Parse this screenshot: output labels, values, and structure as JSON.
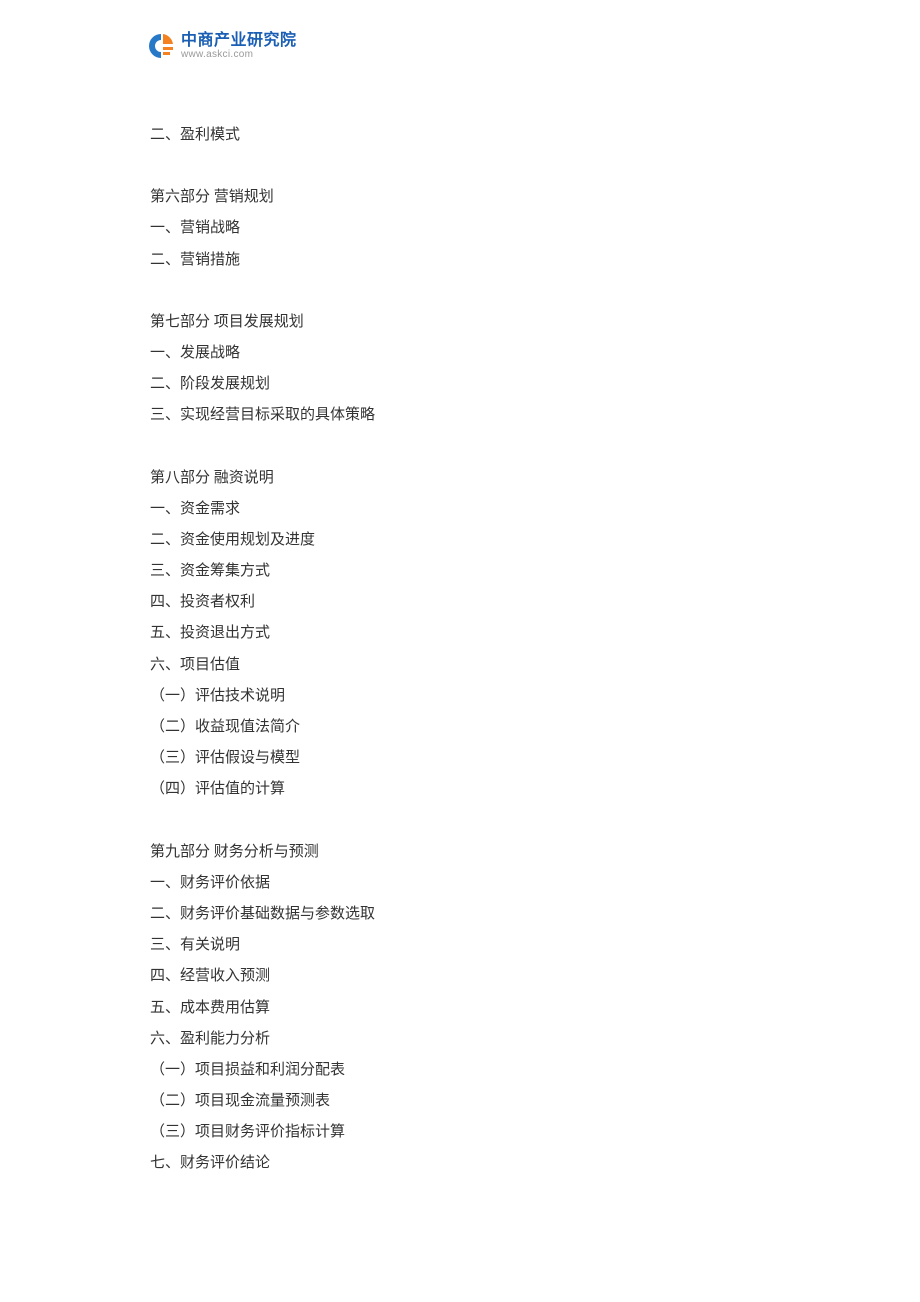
{
  "logo": {
    "title": "中商产业研究院",
    "url": "www.askci.com"
  },
  "toc": {
    "orphan_item": "二、盈利模式",
    "section6": {
      "heading": "第六部分 营销规划",
      "items": [
        "一、营销战略",
        "二、营销措施"
      ]
    },
    "section7": {
      "heading": "第七部分 项目发展规划",
      "items": [
        "一、发展战略",
        "二、阶段发展规划",
        "三、实现经营目标采取的具体策略"
      ]
    },
    "section8": {
      "heading": "第八部分 融资说明",
      "items": [
        "一、资金需求",
        "二、资金使用规划及进度",
        "三、资金筹集方式",
        "四、投资者权利",
        "五、投资退出方式",
        "六、项目估值",
        "（一）评估技术说明",
        "（二）收益现值法简介",
        "（三）评估假设与模型",
        "（四）评估值的计算"
      ]
    },
    "section9": {
      "heading": "第九部分 财务分析与预测",
      "items": [
        "一、财务评价依据",
        "二、财务评价基础数据与参数选取",
        "三、有关说明",
        "四、经营收入预测",
        "五、成本费用估算",
        "六、盈利能力分析",
        "（一）项目损益和利润分配表",
        "（二）项目现金流量预测表",
        "（三）项目财务评价指标计算",
        "七、财务评价结论"
      ]
    }
  }
}
